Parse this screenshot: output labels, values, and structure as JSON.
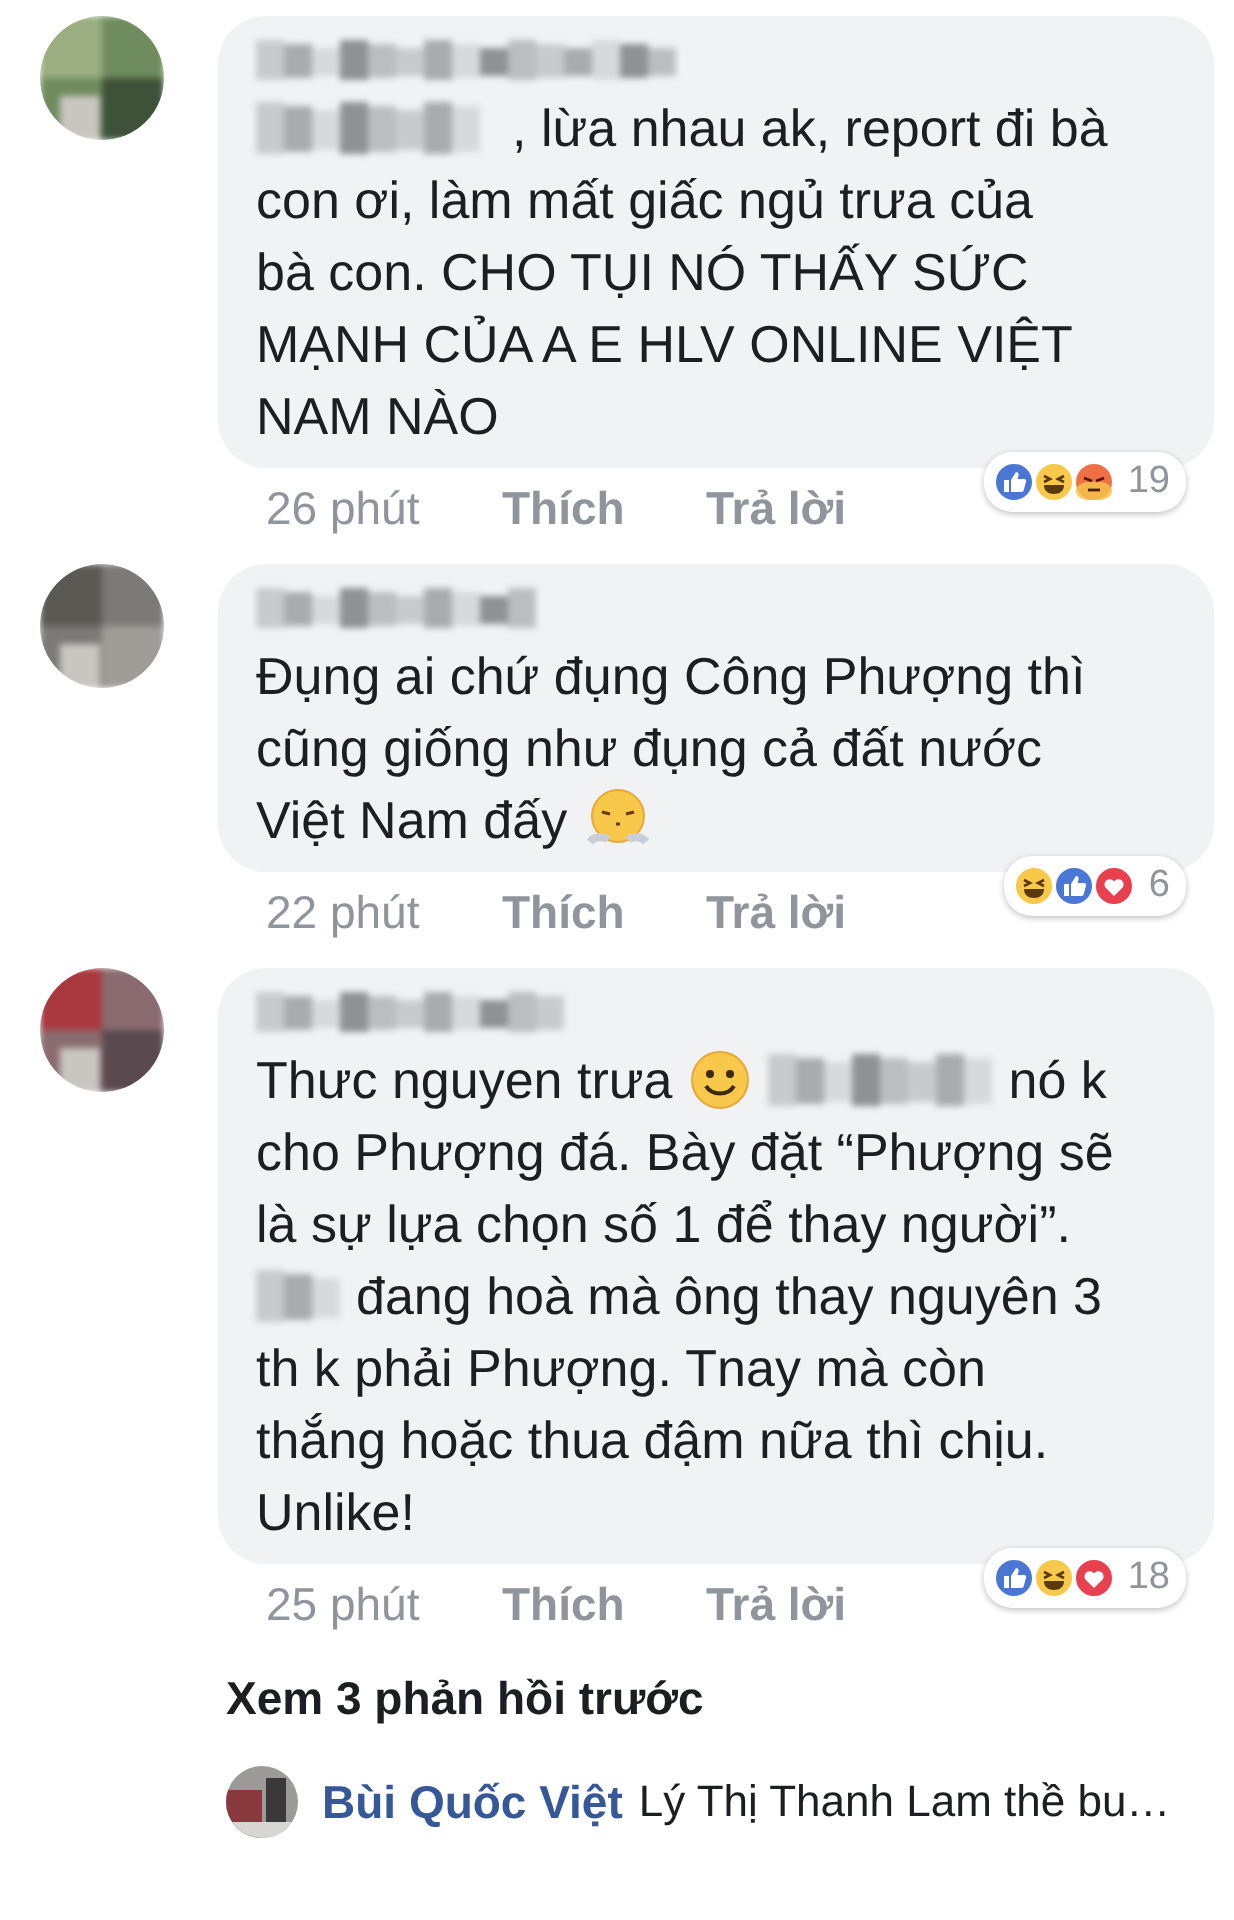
{
  "comments": [
    {
      "lines": [
        [
          {
            "kind": "redacted"
          },
          {
            "kind": "text",
            "text": ",  lừa nhau ak, report đi bà"
          }
        ],
        [
          {
            "kind": "text",
            "text": "con ơi, làm mất giấc ngủ trưa của"
          }
        ],
        [
          {
            "kind": "text",
            "text": "bà con. CHO TỤI NÓ THẤY SỨC"
          }
        ],
        [
          {
            "kind": "text",
            "text": "MẠNH CỦA A E HLV ONLINE VIỆT"
          }
        ],
        [
          {
            "kind": "text",
            "text": "NAM NÀO"
          }
        ]
      ],
      "time": "26 phút",
      "like": "Thích",
      "reply": "Trả lời",
      "reactions": [
        {
          "kind": "like"
        },
        {
          "kind": "haha"
        },
        {
          "kind": "angry"
        }
      ],
      "reaction_count": "19"
    },
    {
      "lines": [
        [
          {
            "kind": "text",
            "text": "Đụng ai chứ đụng Công Phượng thì"
          }
        ],
        [
          {
            "kind": "text",
            "text": "cũng giống như đụng cả đất nước"
          }
        ],
        [
          {
            "kind": "text",
            "text": "Việt Nam đấy"
          },
          {
            "kind": "huffing"
          }
        ]
      ],
      "time": "22 phút",
      "like": "Thích",
      "reply": "Trả lời",
      "reactions": [
        {
          "kind": "haha"
        },
        {
          "kind": "like"
        },
        {
          "kind": "love"
        }
      ],
      "reaction_count": "6"
    },
    {
      "lines": [
        [
          {
            "kind": "text",
            "text": "Thưc nguyen trưa"
          },
          {
            "kind": "smiley"
          },
          {
            "kind": "redacted"
          },
          {
            "kind": "text",
            "text": "nó k"
          }
        ],
        [
          {
            "kind": "text",
            "text": "cho Phượng đá. Bày đặt “Phượng sẽ"
          }
        ],
        [
          {
            "kind": "text",
            "text": "là sự lựa chọn số 1 để thay người”."
          }
        ],
        [
          {
            "kind": "redacted"
          },
          {
            "kind": "text",
            "text": "đang hoà mà ông thay nguyên 3"
          }
        ],
        [
          {
            "kind": "text",
            "text": "th k phải Phượng. Tnay mà còn"
          }
        ],
        [
          {
            "kind": "text",
            "text": "thắng hoặc thua đậm nữa thì chịu."
          }
        ],
        [
          {
            "kind": "text",
            "text": "Unlike!"
          }
        ]
      ],
      "time": "25 phút",
      "like": "Thích",
      "reply": "Trả lời",
      "reactions": [
        {
          "kind": "like"
        },
        {
          "kind": "haha"
        },
        {
          "kind": "love"
        }
      ],
      "reaction_count": "18"
    }
  ],
  "more_replies": "Xem 3 phản hồi trước",
  "latest_reply": {
    "author": "Bùi Quốc Việt",
    "text": "Lý Thị Thanh Lam thề bu…"
  }
}
